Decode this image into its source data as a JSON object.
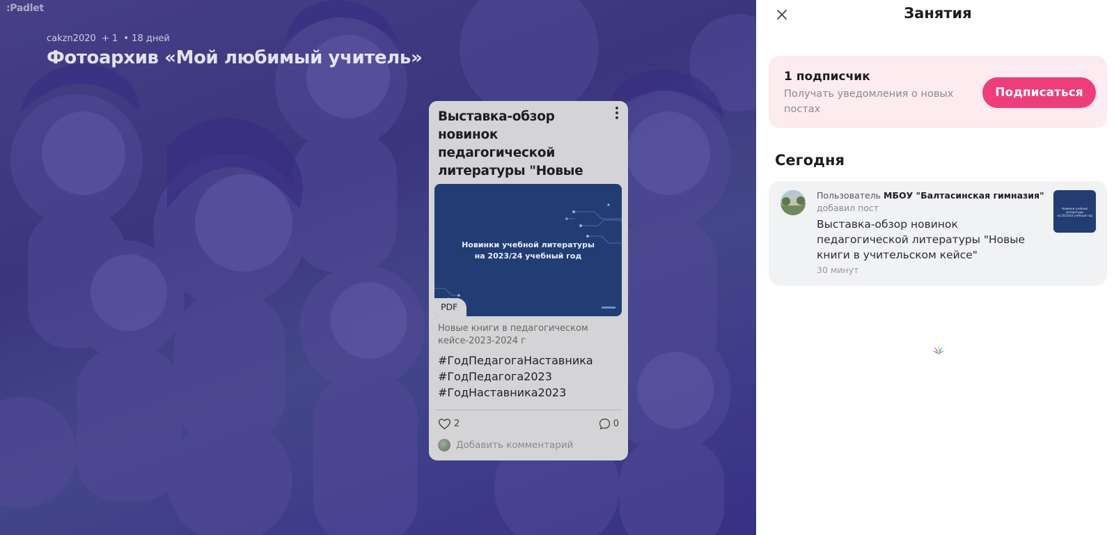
{
  "board": {
    "logo": ":Padlet",
    "author": "cakzn2020",
    "collaborators": "+ 1",
    "age": "• 18 дней",
    "title": "Фотоархив «Мой любимый учитель»"
  },
  "post": {
    "title": "Выставка-обзор новинок педагогической литературы \"Новые книги в учительском кейсе\"",
    "attachment": {
      "type_label": "PDF",
      "preview_line1": "Новинки учебной литературы",
      "preview_line2": "на 2023/24 учебный год",
      "caption": "Новые книги в педагогическом кейсе-2023-2024 г"
    },
    "tags": [
      "#ГодПедагогаНаставника",
      "#ГодПедагога2023",
      "#ГодНаставника2023"
    ],
    "likes": "2",
    "comments": "0",
    "add_comment_placeholder": "Добавить комментарий"
  },
  "panel": {
    "title": "Занятия",
    "subscribe": {
      "count_label": "1 подписчик",
      "description": "Получать уведомления о новых постах",
      "button_label": "Подписаться"
    },
    "section_today": "Сегодня",
    "activity": {
      "user_prefix": "Пользователь",
      "user_name": "МБОУ \"Балтасинская гимназия\"",
      "action": "добавил пост",
      "post_title": "Выставка-обзор новинок педагогической литературы \"Новые книги в учительском кейсе\"",
      "time": "30 минут"
    }
  },
  "colors": {
    "accent": "#ee3d7a",
    "subscribe_bg": "#fcebef",
    "attachment_bg": "#223c74"
  },
  "icons": [
    "close-icon",
    "more-vert-icon",
    "heart-icon",
    "comment-icon",
    "padlet-loader-icon"
  ]
}
